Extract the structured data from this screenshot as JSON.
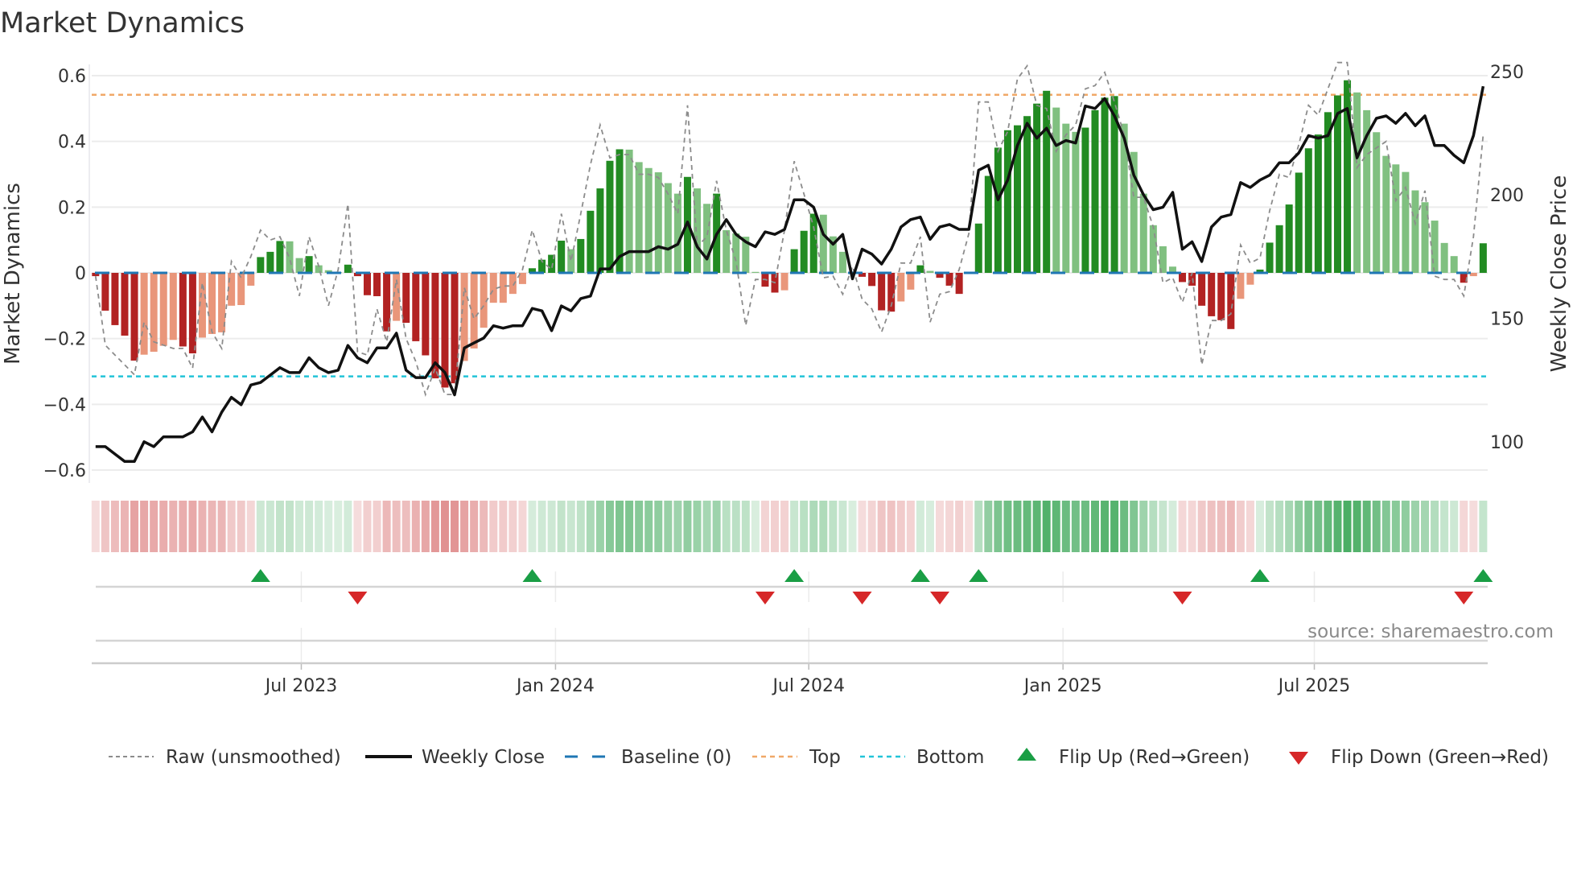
{
  "chart_data": {
    "type": "bar",
    "title": "Market Dynamics",
    "ylabel": "Market Dynamics",
    "y2label": "Weekly Close Price",
    "ylim": [
      -0.62,
      0.62
    ],
    "y2lim": [
      85,
      255
    ],
    "y_ticks": [
      {
        "value": 0.6,
        "label": "0.6"
      },
      {
        "value": 0.4,
        "label": "0.4"
      },
      {
        "value": 0.2,
        "label": "0.2"
      },
      {
        "value": 0,
        "label": "0"
      },
      {
        "value": -0.2,
        "label": "−0.2"
      },
      {
        "value": -0.4,
        "label": "−0.4"
      },
      {
        "value": -0.6,
        "label": "−0.6"
      }
    ],
    "y2_ticks": [
      {
        "value": 250,
        "label": "250"
      },
      {
        "value": 200,
        "label": "200"
      },
      {
        "value": 150,
        "label": "150"
      },
      {
        "value": 100,
        "label": "100"
      }
    ],
    "x_ticks": [
      {
        "week_index": 21.2,
        "label": "Jul 2023"
      },
      {
        "week_index": 47.4,
        "label": "Jan 2024"
      },
      {
        "week_index": 73.5,
        "label": "Jul 2024"
      },
      {
        "week_index": 99.7,
        "label": "Jan 2025"
      },
      {
        "week_index": 125.6,
        "label": "Jul 2025"
      }
    ],
    "grid": true,
    "top_level": 0.542,
    "bottom_level": -0.315,
    "baseline": 0,
    "smoothed": [
      -0.01,
      -0.115,
      -0.159,
      -0.191,
      -0.267,
      -0.249,
      -0.24,
      -0.222,
      -0.204,
      -0.224,
      -0.245,
      -0.197,
      -0.186,
      -0.181,
      -0.1,
      -0.098,
      -0.039,
      0.048,
      0.064,
      0.097,
      0.096,
      0.045,
      0.051,
      0.023,
      0.008,
      0.002,
      0.025,
      -0.01,
      -0.068,
      -0.071,
      -0.178,
      -0.146,
      -0.152,
      -0.208,
      -0.251,
      -0.321,
      -0.349,
      -0.336,
      -0.268,
      -0.23,
      -0.167,
      -0.091,
      -0.091,
      -0.064,
      -0.034,
      0.014,
      0.04,
      0.055,
      0.098,
      0.072,
      0.103,
      0.189,
      0.257,
      0.341,
      0.376,
      0.375,
      0.337,
      0.319,
      0.306,
      0.273,
      0.241,
      0.292,
      0.257,
      0.21,
      0.241,
      0.13,
      0.12,
      0.11,
      0.003,
      -0.042,
      -0.06,
      -0.053,
      0.072,
      0.128,
      0.18,
      0.177,
      0.111,
      0.064,
      0.003,
      -0.012,
      -0.04,
      -0.114,
      -0.118,
      -0.087,
      -0.051,
      0.023,
      0.006,
      -0.015,
      -0.039,
      -0.064,
      -0.002,
      0.15,
      0.295,
      0.381,
      0.434,
      0.449,
      0.477,
      0.515,
      0.554,
      0.503,
      0.454,
      0.429,
      0.442,
      0.495,
      0.533,
      0.538,
      0.454,
      0.368,
      0.241,
      0.145,
      0.081,
      0.019,
      -0.028,
      -0.039,
      -0.1,
      -0.132,
      -0.144,
      -0.171,
      -0.079,
      -0.036,
      0.01,
      0.092,
      0.145,
      0.208,
      0.305,
      0.379,
      0.421,
      0.489,
      0.54,
      0.586,
      0.549,
      0.495,
      0.428,
      0.356,
      0.33,
      0.307,
      0.251,
      0.215,
      0.159,
      0.091,
      0.051,
      -0.03,
      -0.01,
      0.09
    ],
    "shade": "RRRRRrrrrRRrrrrrrGGGggGgggGRRRRrRRRRRRrrrrrrrGGGGgGGGGGggggggGggGgggg RRrGGGgggg RRRRrrGgRRRrGGGGGGGGgggGGGGgggggg RRRRRRrrGGGGGGGGGGgggggggggggRrG",
    "raw": [
      -0.01,
      -0.22,
      -0.25,
      -0.28,
      -0.31,
      -0.15,
      -0.21,
      -0.22,
      -0.23,
      -0.23,
      -0.29,
      -0.03,
      -0.18,
      -0.23,
      0.035,
      -0.015,
      0.05,
      0.13,
      0.1,
      0.11,
      0.044,
      -0.07,
      0.11,
      0.02,
      -0.1,
      0.01,
      0.21,
      -0.24,
      -0.25,
      -0.11,
      -0.21,
      -0.02,
      -0.2,
      -0.27,
      -0.37,
      -0.29,
      -0.37,
      -0.37,
      -0.045,
      -0.14,
      -0.1,
      -0.05,
      -0.04,
      -0.04,
      0.01,
      0.13,
      0.035,
      0.01,
      0.18,
      0.035,
      0.18,
      0.33,
      0.45,
      0.35,
      0.36,
      0.36,
      0.3,
      0.3,
      0.29,
      0.24,
      0.18,
      0.51,
      0.08,
      0.11,
      0.28,
      0.13,
      0.035,
      -0.16,
      -0.02,
      -0.02,
      -0.03,
      0.13,
      0.34,
      0.24,
      0.14,
      -0.015,
      -0.01,
      -0.065,
      0.02,
      -0.08,
      -0.11,
      -0.18,
      -0.1,
      0.03,
      0.03,
      0.11,
      -0.15,
      -0.065,
      -0.057,
      0.01,
      0.12,
      0.52,
      0.52,
      0.37,
      0.43,
      0.59,
      0.63,
      0.51,
      0.5,
      0.37,
      0.42,
      0.45,
      0.56,
      0.57,
      0.61,
      0.52,
      0.42,
      0.23,
      0.23,
      0.14,
      -0.03,
      -0.015,
      -0.09,
      0.0,
      -0.28,
      -0.145,
      -0.145,
      -0.125,
      0.085,
      0.03,
      0.045,
      0.19,
      0.3,
      0.29,
      0.39,
      0.51,
      0.48,
      0.56,
      0.64,
      0.64,
      0.32,
      0.36,
      0.38,
      0.4,
      0.22,
      0.26,
      0.15,
      0.25,
      -0.01,
      -0.02,
      -0.02,
      -0.07,
      0.11,
      0.42
    ],
    "weekly_close": [
      98,
      98,
      95,
      92,
      92,
      100,
      98,
      102,
      102,
      102,
      104,
      110,
      104,
      112,
      118,
      115,
      123,
      124,
      127,
      130,
      128,
      128,
      134,
      130,
      128,
      129,
      139,
      134,
      132,
      138,
      138,
      144,
      129,
      126,
      126,
      132,
      128,
      119,
      138,
      140,
      142,
      147,
      146,
      147,
      147,
      154,
      153,
      145,
      155,
      153,
      158,
      159,
      170,
      170,
      175,
      177,
      177,
      177,
      179,
      178,
      180,
      189,
      179,
      174,
      184,
      190,
      184,
      181,
      179,
      185,
      184,
      186,
      198,
      198,
      195,
      184,
      180,
      184,
      166,
      178,
      176,
      172,
      178,
      187,
      190,
      191,
      182,
      187,
      188,
      186,
      186,
      210,
      212,
      198,
      206,
      220,
      229,
      223,
      227,
      220,
      222,
      221,
      236,
      235,
      239,
      232,
      223,
      208,
      200,
      194,
      195,
      201,
      178,
      181,
      173,
      187,
      191,
      192,
      205,
      203,
      206,
      208,
      213,
      213,
      217,
      224,
      223,
      224,
      233,
      235,
      215,
      224,
      231,
      232,
      229,
      233,
      228,
      232,
      220,
      220,
      216,
      213,
      224,
      244
    ],
    "flip_up_week_index": [
      17,
      45,
      72,
      85,
      91,
      120,
      143
    ],
    "flip_down_week_index": [
      27,
      69,
      79,
      87,
      112,
      141
    ],
    "legend": {
      "placement": "bottom",
      "items": [
        {
          "label": "Raw (unsmoothed)"
        },
        {
          "label": "Weekly Close"
        },
        {
          "label": "Baseline (0)"
        },
        {
          "label": "Top"
        },
        {
          "label": "Bottom"
        },
        {
          "label": "Flip Up (Red→Green)"
        },
        {
          "label": "Flip Down (Green→Red)"
        }
      ]
    },
    "source": "source: sharemaestro.com",
    "colors": {
      "up_strong": "#228b22",
      "up_weak": "#80c080",
      "down_strong": "#b22222",
      "down_weak": "#e9967a",
      "raw": "#8c8c8c",
      "close": "#111111",
      "baseline": "#1f77b4",
      "top": "#f0a868",
      "bottom": "#22c4d8",
      "flip_up": "#1a9e45",
      "flip_down": "#d62728",
      "strip_up": "#2ca04a",
      "strip_down": "#cc4444"
    }
  }
}
